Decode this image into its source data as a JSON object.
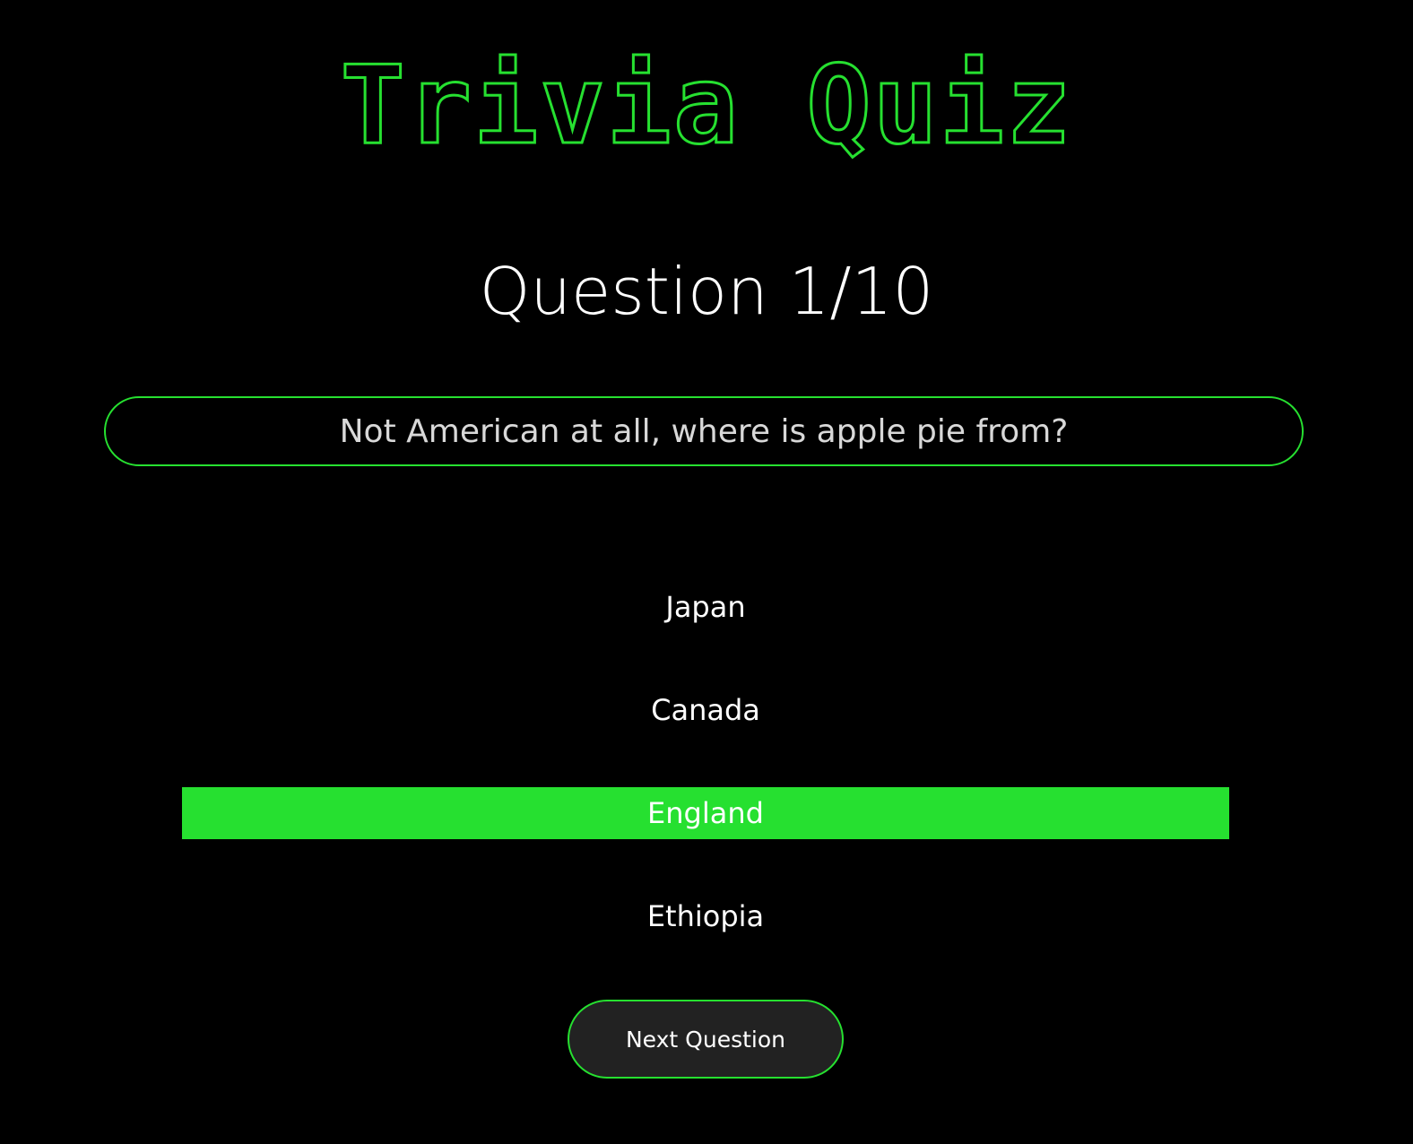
{
  "header": {
    "title": "Trivia Quiz"
  },
  "quiz": {
    "counter": "Question 1/10",
    "question": "Not American at all, where is apple pie from?",
    "answers": [
      {
        "label": "Japan",
        "selected": false
      },
      {
        "label": "Canada",
        "selected": false
      },
      {
        "label": "England",
        "selected": true
      },
      {
        "label": "Ethiopia",
        "selected": false
      }
    ],
    "next_label": "Next Question"
  },
  "colors": {
    "background": "#000000",
    "accent": "#26e030",
    "button_bg": "#222222",
    "question_text": "#d8d8d8"
  }
}
